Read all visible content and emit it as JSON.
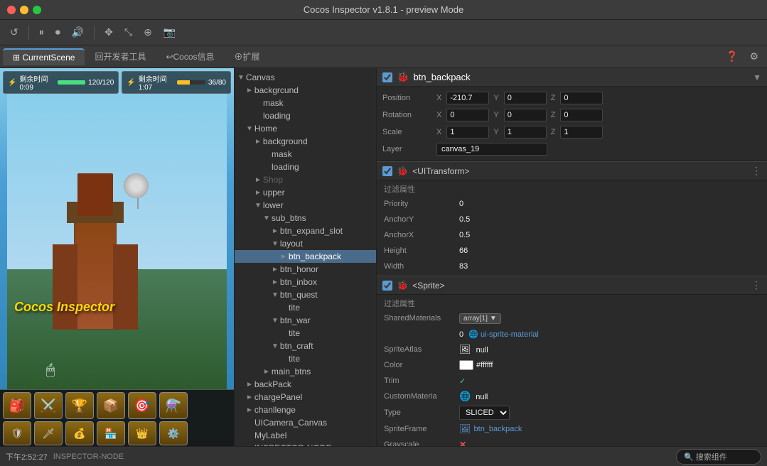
{
  "titleBar": {
    "title": "Cocos Inspector v1.8.1 - preview Mode"
  },
  "tabs": {
    "items": [
      {
        "label": "⊞ CurrentScene",
        "active": true
      },
      {
        "label": "回开发者工具",
        "active": false
      },
      {
        "label": "↩Cocos信息",
        "active": false
      },
      {
        "label": "⊕扩展",
        "active": false
      }
    ]
  },
  "sceneTree": {
    "items": [
      {
        "label": "Canvas",
        "level": 0,
        "expanded": true,
        "arrow": "▼",
        "icon": ""
      },
      {
        "label": "backgrcund",
        "level": 1,
        "expanded": true,
        "arrow": "►",
        "icon": ""
      },
      {
        "label": "mask",
        "level": 2,
        "expanded": false,
        "arrow": "",
        "icon": ""
      },
      {
        "label": "loading",
        "level": 2,
        "expanded": false,
        "arrow": "",
        "icon": ""
      },
      {
        "label": "Home",
        "level": 1,
        "expanded": true,
        "arrow": "▼",
        "icon": ""
      },
      {
        "label": "background",
        "level": 2,
        "expanded": false,
        "arrow": "►",
        "icon": ""
      },
      {
        "label": "mask",
        "level": 3,
        "expanded": false,
        "arrow": "",
        "icon": ""
      },
      {
        "label": "loading",
        "level": 3,
        "expanded": false,
        "arrow": "",
        "icon": ""
      },
      {
        "label": "Shop",
        "level": 2,
        "expanded": false,
        "arrow": "►",
        "icon": ""
      },
      {
        "label": "upper",
        "level": 2,
        "expanded": false,
        "arrow": "►",
        "icon": ""
      },
      {
        "label": "lower",
        "level": 2,
        "expanded": true,
        "arrow": "▼",
        "icon": ""
      },
      {
        "label": "sub_btns",
        "level": 3,
        "expanded": true,
        "arrow": "▼",
        "icon": ""
      },
      {
        "label": "btn_expand_slot",
        "level": 4,
        "expanded": false,
        "arrow": "►",
        "icon": ""
      },
      {
        "label": "layout",
        "level": 4,
        "expanded": true,
        "arrow": "▼",
        "icon": ""
      },
      {
        "label": "btn_backpack",
        "level": 5,
        "expanded": false,
        "arrow": "►",
        "icon": "",
        "selected": true
      },
      {
        "label": "btn_honor",
        "level": 4,
        "expanded": false,
        "arrow": "►",
        "icon": ""
      },
      {
        "label": "btn_inbox",
        "level": 4,
        "expanded": false,
        "arrow": "►",
        "icon": ""
      },
      {
        "label": "btn_quest",
        "level": 4,
        "expanded": true,
        "arrow": "▼",
        "icon": ""
      },
      {
        "label": "tite",
        "level": 5,
        "expanded": false,
        "arrow": "",
        "icon": ""
      },
      {
        "label": "btn_war",
        "level": 4,
        "expanded": true,
        "arrow": "▼",
        "icon": ""
      },
      {
        "label": "tite",
        "level": 5,
        "expanded": false,
        "arrow": "",
        "icon": ""
      },
      {
        "label": "btn_craft",
        "level": 4,
        "expanded": true,
        "arrow": "▼",
        "icon": ""
      },
      {
        "label": "tite",
        "level": 5,
        "expanded": false,
        "arrow": "",
        "icon": ""
      },
      {
        "label": "main_btns",
        "level": 3,
        "expanded": false,
        "arrow": "►",
        "icon": ""
      },
      {
        "label": "backPack",
        "level": 1,
        "expanded": false,
        "arrow": "►",
        "icon": ""
      },
      {
        "label": "chargePanel",
        "level": 1,
        "expanded": false,
        "arrow": "►",
        "icon": ""
      },
      {
        "label": "chanllenge",
        "level": 1,
        "expanded": false,
        "arrow": "►",
        "icon": ""
      },
      {
        "label": "UICamera_Canvas",
        "level": 1,
        "expanded": false,
        "arrow": "",
        "icon": ""
      },
      {
        "label": "MyLabel",
        "level": 1,
        "expanded": false,
        "arrow": "",
        "icon": ""
      },
      {
        "label": "INSPECTOR-NODE",
        "level": 1,
        "expanded": false,
        "arrow": "",
        "icon": ""
      }
    ]
  },
  "inspector": {
    "nodeName": "btn_backpack",
    "nodeIcon": "🐞",
    "position": {
      "x": "-210.7",
      "y": "0",
      "z": "0"
    },
    "rotation": {
      "x": "0",
      "y": "0",
      "z": "0"
    },
    "scale": {
      "x": "1",
      "y": "1",
      "z": "1"
    },
    "layer": "canvas_19",
    "components": {
      "uitransform": {
        "name": "<UITransform>",
        "priority": "0",
        "anchorY": "0.5",
        "anchorX": "0.5",
        "height": "66",
        "width": "83"
      },
      "sprite": {
        "name": "<Sprite>",
        "sharedMaterials": "array[1]",
        "sharedMaterialValue": "0",
        "sharedMaterialLink": "ui-sprite-material",
        "spriteAtlas": "null",
        "color": "#ffffff",
        "trim": "✓",
        "customMaterial": "null",
        "type": "SLICED",
        "spriteFrame": "btn_backpack",
        "grayscale": "✕"
      }
    }
  },
  "hud": {
    "timer1Label": "剩余时间 0:09",
    "timer1Value": "120/120",
    "timer2Label": "剩余时间 1:07",
    "timer2Value": "36/80"
  },
  "statusBar": {
    "time": "下午2:52:27",
    "label": "INSPECTOR-NODE",
    "searchPlaceholder": "🔍 搜索组件"
  },
  "previewTitle": "Cocos Inspector",
  "toolbar": {
    "refreshIcon": "↺",
    "pauseIcon": "⏸",
    "recordIcon": "⏺",
    "audioIcon": "🔊",
    "moveIcon": "✥",
    "scaleIcon": "⤡",
    "anchorIcon": "⊕",
    "screenshotIcon": "📷"
  }
}
